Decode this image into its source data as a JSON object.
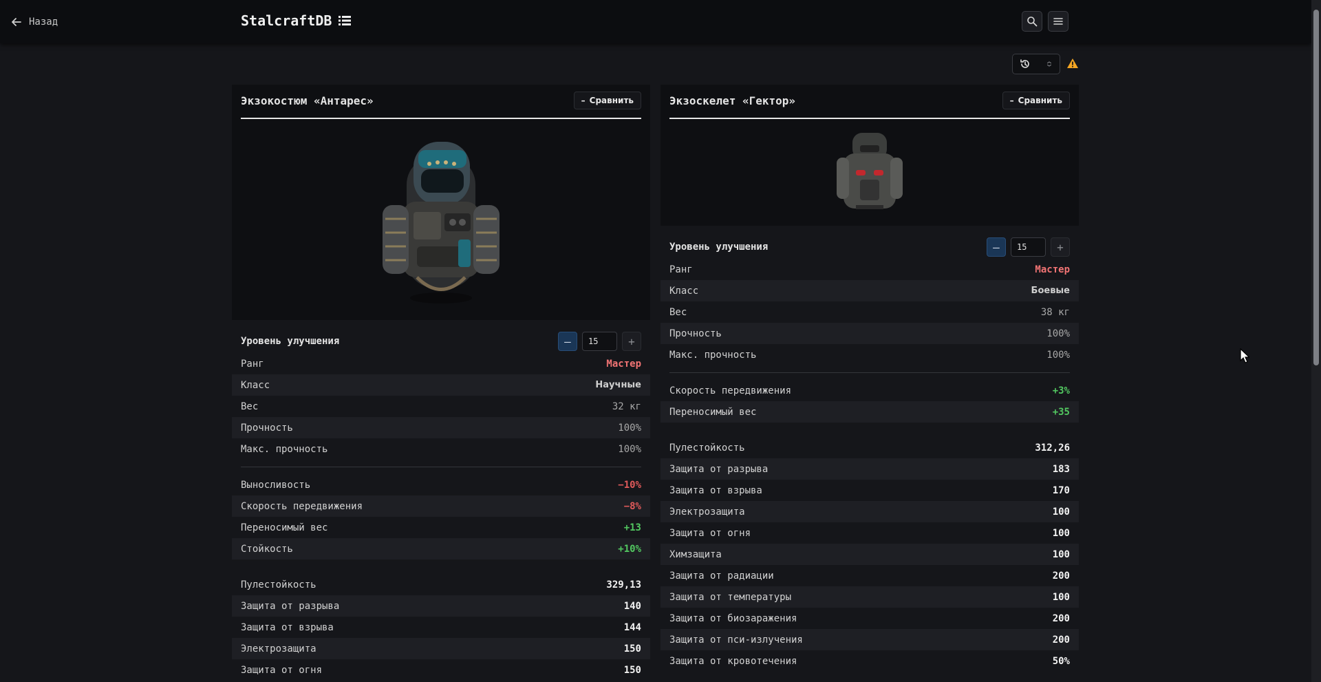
{
  "header": {
    "back_label": "Назад",
    "brand": "StalcraftDB"
  },
  "left": {
    "title": "Экзокостюм «Антарес»",
    "compare_label": "Сравнить",
    "upgrade_label": "Уровень улучшения",
    "upgrade_value": "15",
    "basic": [
      {
        "label": "Ранг",
        "value": "Мастер",
        "kind": "rank"
      },
      {
        "label": "Класс",
        "value": "Научные",
        "kind": "cls"
      },
      {
        "label": "Вес",
        "value": "32 кг",
        "kind": "plain"
      },
      {
        "label": "Прочность",
        "value": "100%",
        "kind": "plain"
      },
      {
        "label": "Макс. прочность",
        "value": "100%",
        "kind": "plain"
      }
    ],
    "bonuses": [
      {
        "label": "Выносливость",
        "value": "−10%",
        "kind": "neg"
      },
      {
        "label": "Скорость передвижения",
        "value": "−8%",
        "kind": "neg"
      },
      {
        "label": "Переносимый вес",
        "value": "+13",
        "kind": "pos"
      },
      {
        "label": "Стойкость",
        "value": "+10%",
        "kind": "pos"
      }
    ],
    "protection": [
      {
        "label": "Пулестойкость",
        "value": "329,13"
      },
      {
        "label": "Защита от разрыва",
        "value": "140"
      },
      {
        "label": "Защита от взрыва",
        "value": "144"
      },
      {
        "label": "Электрозащита",
        "value": "150"
      },
      {
        "label": "Защита от огня",
        "value": "150"
      }
    ]
  },
  "right": {
    "title": "Экзоскелет «Гектор»",
    "compare_label": "Сравнить",
    "upgrade_label": "Уровень улучшения",
    "upgrade_value": "15",
    "basic": [
      {
        "label": "Ранг",
        "value": "Мастер",
        "kind": "rank"
      },
      {
        "label": "Класс",
        "value": "Боевые",
        "kind": "cls"
      },
      {
        "label": "Вес",
        "value": "38 кг",
        "kind": "plain"
      },
      {
        "label": "Прочность",
        "value": "100%",
        "kind": "plain"
      },
      {
        "label": "Макс. прочность",
        "value": "100%",
        "kind": "plain"
      }
    ],
    "bonuses": [
      {
        "label": "Скорость передвижения",
        "value": "+3%",
        "kind": "pos"
      },
      {
        "label": "Переносимый вес",
        "value": "+35",
        "kind": "pos"
      }
    ],
    "protection": [
      {
        "label": "Пулестойкость",
        "value": "312,26"
      },
      {
        "label": "Защита от разрыва",
        "value": "183"
      },
      {
        "label": "Защита от взрыва",
        "value": "170"
      },
      {
        "label": "Электрозащита",
        "value": "100"
      },
      {
        "label": "Защита от огня",
        "value": "100"
      },
      {
        "label": "Химзащита",
        "value": "100"
      },
      {
        "label": "Защита от радиации",
        "value": "200"
      },
      {
        "label": "Защита от температуры",
        "value": "100"
      },
      {
        "label": "Защита от биозаражения",
        "value": "200"
      },
      {
        "label": "Защита от пси-излучения",
        "value": "200"
      },
      {
        "label": "Защита от кровотечения",
        "value": "50%"
      }
    ]
  },
  "colors": {
    "rank": "#f27474",
    "negative": "#e05a5a",
    "positive": "#52c760",
    "warning": "#f5a623"
  },
  "icons": [
    "arrow-left-icon",
    "list-icon",
    "search-icon",
    "menu-icon",
    "history-icon",
    "updown-chevron-icon",
    "warning-icon",
    "minus-icon",
    "plus-icon"
  ]
}
